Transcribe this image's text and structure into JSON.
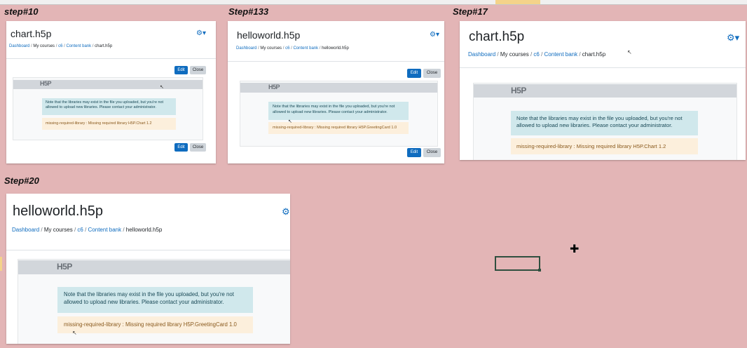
{
  "steps": [
    {
      "label": "step#10",
      "title": "chart.h5p",
      "breadcrumb": {
        "dashboard": "Dashboard",
        "my_courses": "My courses",
        "course": "c6",
        "content_bank": "Content bank",
        "current": "chart.h5p"
      },
      "h5p_logo": "H5P",
      "info": "Note that the libraries may exist in the file you uploaded, but you're not allowed to upload new libraries. Please contact your administrator.",
      "warning": "missing-required-library : Missing required library H5P.Chart 1.2",
      "edit_label": "Edit",
      "close_label": "Close"
    },
    {
      "label": "Step#133",
      "title": "helloworld.h5p",
      "breadcrumb": {
        "dashboard": "Dashboard",
        "my_courses": "My courses",
        "course": "c6",
        "content_bank": "Content bank",
        "current": "helloworld.h5p"
      },
      "h5p_logo": "H5P",
      "info": "Note that the libraries may exist in the file you uploaded, but you're not allowed to upload new libraries. Please contact your administrator.",
      "warning": "missing-required-library : Missing required library H5P.GreetingCard 1.0",
      "edit_label": "Edit",
      "close_label": "Close"
    },
    {
      "label": "Step#17",
      "title": "chart.h5p",
      "breadcrumb": {
        "dashboard": "Dashboard",
        "my_courses": "My courses",
        "course": "c6",
        "content_bank": "Content bank",
        "current": "chart.h5p"
      },
      "h5p_logo": "H5P",
      "info": "Note that the libraries may exist in the file you uploaded, but you're not allowed to upload new libraries. Please contact your administrator.",
      "warning": "missing-required-library : Missing required library H5P.Chart 1.2"
    },
    {
      "label": "Step#20",
      "title": "helloworld.h5p",
      "breadcrumb": {
        "dashboard": "Dashboard",
        "my_courses": "My courses",
        "course": "c6",
        "content_bank": "Content bank",
        "current": "helloworld.h5p"
      },
      "h5p_logo": "H5P",
      "info": "Note that the libraries may exist in the file you uploaded, but you're not allowed to upload new libraries. Please contact your administrator.",
      "warning": "missing-required-library : Missing required library H5P.GreetingCard 1.0"
    }
  ],
  "icons": {
    "gear": "gear-icon",
    "cursor": "pointer-icon",
    "cell_cursor": "plus-cursor-icon"
  },
  "colors": {
    "background": "#e3b5b6",
    "link": "#0f6cbf",
    "info_bg": "#d0e8ec",
    "warning_bg": "#fcefdc",
    "edit_button": "#0f6cbf"
  }
}
